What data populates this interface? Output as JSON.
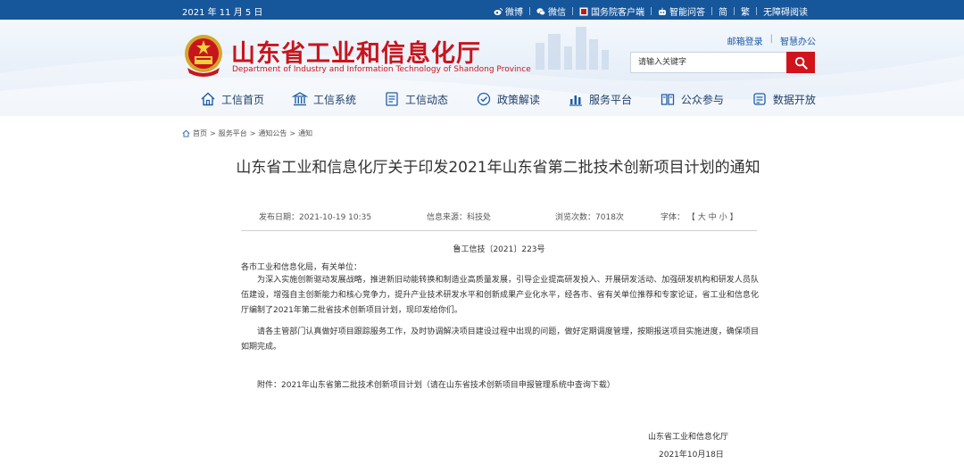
{
  "topbar": {
    "date": "2021 年 11 月 5 日",
    "links": [
      {
        "icon": "weibo-icon",
        "label": "微博"
      },
      {
        "icon": "wechat-icon",
        "label": "微信"
      },
      {
        "icon": "state-council-client-icon",
        "label": "国务院客户端"
      },
      {
        "icon": "smart-qa-icon",
        "label": "智能问答"
      },
      {
        "icon": "",
        "label": "简"
      },
      {
        "icon": "",
        "label": "繁"
      },
      {
        "icon": "",
        "label": "无障碍阅读"
      }
    ]
  },
  "header": {
    "brand_cn": "山东省工业和信息化厅",
    "brand_en": "Department of Industry and Information Technology of Shandong Province",
    "links": [
      "邮箱登录",
      "智慧办公"
    ],
    "search": {
      "placeholder": "请输入关键字"
    },
    "colors": {
      "brand_red": "#c8151d",
      "topbar_blue": "#16569b",
      "search_red": "#d0141c"
    }
  },
  "nav": {
    "items": [
      {
        "icon": "home-icon",
        "label": "工信首页"
      },
      {
        "icon": "building-icon",
        "label": "工信系统"
      },
      {
        "icon": "news-icon",
        "label": "工信动态"
      },
      {
        "icon": "policy-icon",
        "label": "政策解读"
      },
      {
        "icon": "service-icon",
        "label": "服务平台"
      },
      {
        "icon": "participation-icon",
        "label": "公众参与"
      },
      {
        "icon": "data-icon",
        "label": "数据开放"
      }
    ]
  },
  "breadcrumb": {
    "items": [
      "首页",
      "服务平台",
      "通知公告",
      "通知"
    ],
    "separator": ">"
  },
  "article": {
    "title": "山东省工业和信息化厅关于印发2021年山东省第二批技术创新项目计划的通知",
    "publish_label": "发布日期：",
    "publish_date": "2021-10-19 10:35",
    "source_label": "信息来源：",
    "source": "科技处",
    "views_label": "浏览次数：",
    "views": "7018次",
    "font_label": "字体：",
    "font_open": "【",
    "font_large": "大",
    "font_medium": "中",
    "font_small": "小",
    "font_close": "】",
    "doc_no": "鲁工信技〔2021〕223号",
    "salutation": "各市工业和信息化局，有关单位：",
    "paragraph1": "为深入实施创新驱动发展战略，推进新旧动能转换和制造业高质量发展，引导企业提高研发投入、开展研发活动、加强研发机构和研发人员队伍建设，增强自主创新能力和核心竞争力，提升产业技术研发水平和创新成果产业化水平，经各市、省有关单位推荐和专家论证，省工业和信息化厅编制了2021年第二批省技术创新项目计划，现印发给你们。",
    "paragraph2": "请各主管部门认真做好项目跟踪服务工作，及时协调解决项目建设过程中出现的问题，做好定期调度管理，按期报送项目实施进度，确保项目如期完成。",
    "attachment": "附件：2021年山东省第二批技术创新项目计划（请在山东省技术创新项目申报管理系统中查询下载）",
    "signer": "山东省工业和信息化厅",
    "sign_date": "2021年10月18日"
  }
}
